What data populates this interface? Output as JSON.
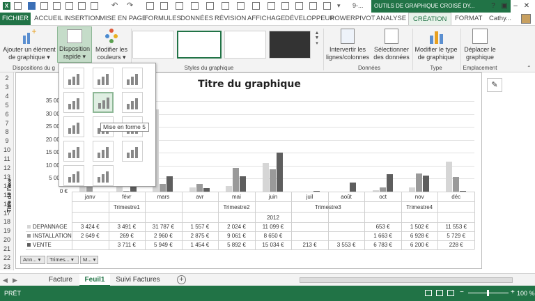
{
  "titlebar": {
    "context_tools": "OUTILS DE GRAPHIQUE CROISÉ DY...",
    "window_title_fragment": "9-..."
  },
  "tabs": [
    "FICHIER",
    "ACCUEIL",
    "INSERTION",
    "MISE EN PAGE",
    "FORMULES",
    "DONNÉES",
    "RÉVISION",
    "AFFICHAGE",
    "DÉVELOPPEUR",
    "POWERPIVOT",
    "ANALYSE",
    "CRÉATION",
    "FORMAT"
  ],
  "user": "Cathy...",
  "ribbon": {
    "add_element": [
      "Ajouter un élément",
      "de graphique ▾"
    ],
    "quick_layout": [
      "Disposition",
      "rapide ▾"
    ],
    "change_colors": [
      "Modifier les",
      "couleurs ▾"
    ],
    "switch_rowcol": [
      "Intervertir les",
      "lignes/colonnes"
    ],
    "select_data": [
      "Sélectionner",
      "des données"
    ],
    "change_type": [
      "Modifier le type",
      "de graphique"
    ],
    "move_chart": [
      "Déplacer le",
      "graphique"
    ],
    "groups": {
      "layouts": "Dispositions du g",
      "styles": "Styles du graphique",
      "data": "Données",
      "type": "Type",
      "location": "Emplacement"
    }
  },
  "popup": {
    "tooltip": "Mise en forme 5"
  },
  "rows": [
    "2",
    "3",
    "4",
    "5",
    "6",
    "7",
    "8",
    "9",
    "10",
    "11",
    "12",
    "13",
    "14",
    "15",
    "16",
    "17",
    "18",
    "19",
    "20",
    "21",
    "22",
    "23"
  ],
  "chart_data": {
    "type": "bar",
    "title": "Titre du graphique",
    "ylabel": "Titre de l'axe",
    "yticks": [
      "35 000 €",
      "30 000 €",
      "25 000 €",
      "20 000 €",
      "15 000 €",
      "10 000 €",
      "5 000 €",
      "0 €"
    ],
    "ylim": [
      0,
      35000
    ],
    "categories": [
      "janv",
      "févr",
      "mars",
      "avr",
      "mai",
      "juin",
      "juil",
      "août",
      "oct",
      "nov",
      "déc"
    ],
    "quarters": [
      "Trimestre1",
      "Trimestre2",
      "Trimestre3",
      "Trimestre4"
    ],
    "year": "2012",
    "series": [
      {
        "name": "DEPANNAGE",
        "color": "#d6d6d6",
        "values": [
          3424,
          3491,
          31787,
          1557,
          2024,
          11099,
          0,
          0,
          653,
          1502,
          11553
        ],
        "labels": [
          "3 424 €",
          "3 491 €",
          "31 787 €",
          "1 557 €",
          "2 024 €",
          "11 099 €",
          "",
          "",
          "653 €",
          "1 502 €",
          "11 553 €"
        ]
      },
      {
        "name": "INSTALLATION",
        "color": "#9a9a9a",
        "values": [
          2649,
          269,
          2960,
          2875,
          9061,
          8650,
          0,
          0,
          1663,
          6928,
          5729
        ],
        "labels": [
          "2 649 €",
          "269 €",
          "2 960 €",
          "2 875 €",
          "9 061 €",
          "8 650 €",
          "",
          "",
          "1 663 €",
          "6 928 €",
          "5 729 €"
        ]
      },
      {
        "name": "VENTE",
        "color": "#5e5e5e",
        "values": [
          0,
          3711,
          5949,
          1454,
          5892,
          15034,
          213,
          3553,
          6783,
          6200,
          228
        ],
        "labels": [
          "",
          "3 711 €",
          "5 949 €",
          "1 454 €",
          "5 892 €",
          "15 034 €",
          "213 €",
          "3 553 €",
          "6 783 €",
          "6 200 €",
          "228 €"
        ]
      }
    ]
  },
  "filters": [
    "Ann...",
    "Trimes...",
    "M..."
  ],
  "sheets": [
    "Facture",
    "Feuil1",
    "Suivi Factures"
  ],
  "status": {
    "ready": "PRÊT",
    "zoom": "100 %"
  },
  "colors": {
    "excel_green": "#217346"
  }
}
